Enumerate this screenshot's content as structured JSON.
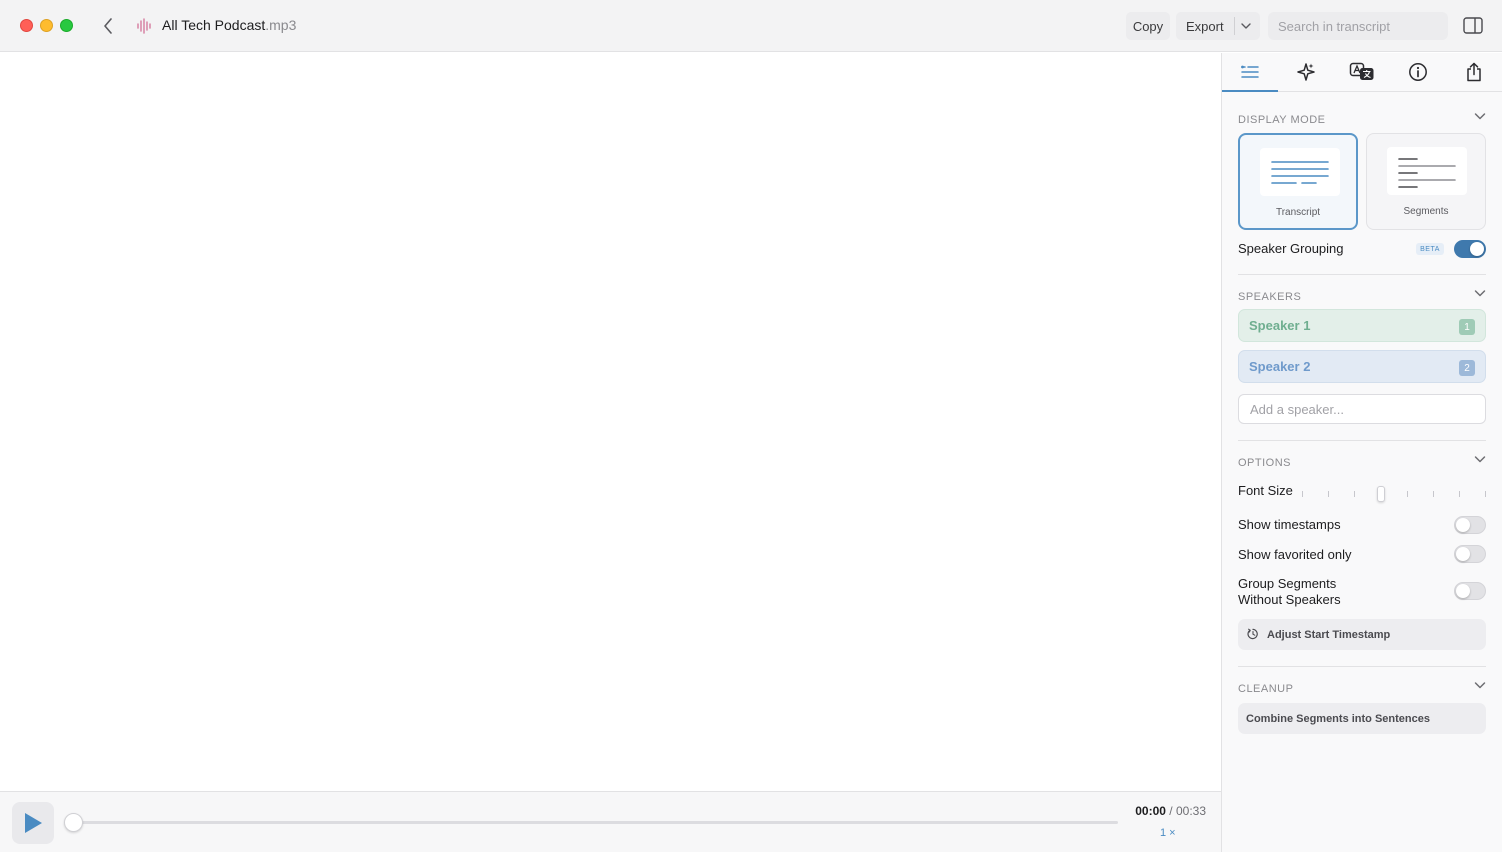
{
  "titlebar": {
    "file_name": "All Tech Podcast",
    "file_ext": ".mp3",
    "copy_label": "Copy",
    "export_label": "Export",
    "search_placeholder": "Search in transcript"
  },
  "player": {
    "current_time": "00:00",
    "separator": " / ",
    "duration": "00:33",
    "speed": "1 ×",
    "progress": 0
  },
  "sidebar": {
    "tabs": [
      {
        "name": "transcript-view-icon",
        "active": true
      },
      {
        "name": "ai-sparkle-icon",
        "active": false
      },
      {
        "name": "translate-icon",
        "active": false
      },
      {
        "name": "info-icon",
        "active": false
      },
      {
        "name": "share-icon",
        "active": false
      }
    ],
    "display_mode": {
      "title": "Display Mode",
      "modes": [
        {
          "label": "Transcript",
          "selected": true
        },
        {
          "label": "Segments",
          "selected": false
        }
      ],
      "speaker_grouping_label": "Speaker Grouping",
      "beta_badge": "BETA",
      "speaker_grouping_on": true
    },
    "speakers": {
      "title": "Speakers",
      "items": [
        {
          "label": "Speaker 1",
          "number": "1",
          "color": "#6fae90"
        },
        {
          "label": "Speaker 2",
          "number": "2",
          "color": "#6f9acb"
        }
      ],
      "add_placeholder": "Add a speaker..."
    },
    "options": {
      "title": "Options",
      "font_size_label": "Font Size",
      "font_size_level": 0.43,
      "show_timestamps_label": "Show timestamps",
      "show_timestamps_on": false,
      "show_favorited_label": "Show favorited only",
      "show_favorited_on": false,
      "group_segments_line1": "Group Segments",
      "group_segments_line2": "Without Speakers",
      "group_segments_on": false,
      "adjust_start_label": "Adjust Start Timestamp"
    },
    "cleanup": {
      "title": "Cleanup",
      "combine_label": "Combine Segments into Sentences"
    }
  },
  "colors": {
    "accent": "#4a8bc2",
    "close": "#ff5f57",
    "minimize": "#febc2e",
    "maximize": "#28c840"
  }
}
